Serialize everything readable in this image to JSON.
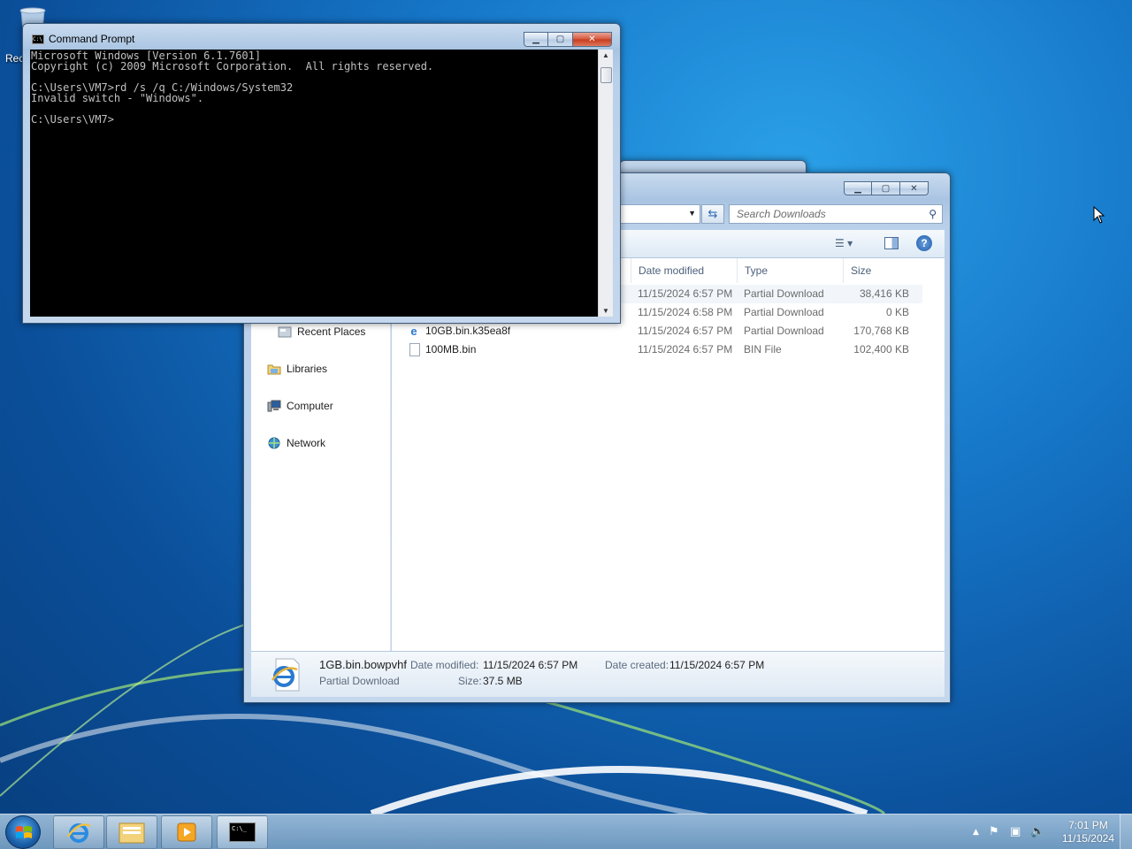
{
  "desktop": {
    "recycle_bin_label": "Rec"
  },
  "cmd": {
    "title": "Command Prompt",
    "icon_text": "C:\\",
    "lines": [
      "Microsoft Windows [Version 6.1.7601]",
      "Copyright (c) 2009 Microsoft Corporation.  All rights reserved.",
      "",
      "C:\\Users\\VM7>rd /s /q C:/Windows/System32",
      "Invalid switch - \"Windows\".",
      "",
      "C:\\Users\\VM7>"
    ]
  },
  "explorer": {
    "search_placeholder": "Search Downloads",
    "columns": {
      "date": "Date modified",
      "type": "Type",
      "size": "Size"
    },
    "nav": [
      {
        "label": "Recent Places",
        "icon": "recent-places-icon"
      },
      {
        "label": "Libraries",
        "icon": "libraries-icon"
      },
      {
        "label": "Computer",
        "icon": "computer-icon"
      },
      {
        "label": "Network",
        "icon": "network-icon"
      }
    ],
    "files": [
      {
        "name": "",
        "date": "11/15/2024 6:57 PM",
        "type": "Partial Download",
        "size": "38,416 KB",
        "icon": "ie-file-icon"
      },
      {
        "name": "",
        "date": "11/15/2024 6:58 PM",
        "type": "Partial Download",
        "size": "0 KB",
        "icon": "ie-file-icon"
      },
      {
        "name": "10GB.bin.k35ea8f",
        "date": "11/15/2024 6:57 PM",
        "type": "Partial Download",
        "size": "170,768 KB",
        "icon": "ie-file-icon"
      },
      {
        "name": "100MB.bin",
        "date": "11/15/2024 6:57 PM",
        "type": "BIN File",
        "size": "102,400 KB",
        "icon": "blank-file-icon"
      }
    ],
    "details": {
      "filename": "1GB.bin.bowpvhf",
      "filetype": "Partial Download",
      "date_modified_label": "Date modified:",
      "date_modified": "11/15/2024 6:57 PM",
      "size_label": "Size:",
      "size": "37.5 MB",
      "date_created_label": "Date created:",
      "date_created": "11/15/2024 6:57 PM"
    }
  },
  "taskbar": {
    "time": "7:01 PM",
    "date": "11/15/2024",
    "cmd_thumb_text": "C:\\_"
  }
}
